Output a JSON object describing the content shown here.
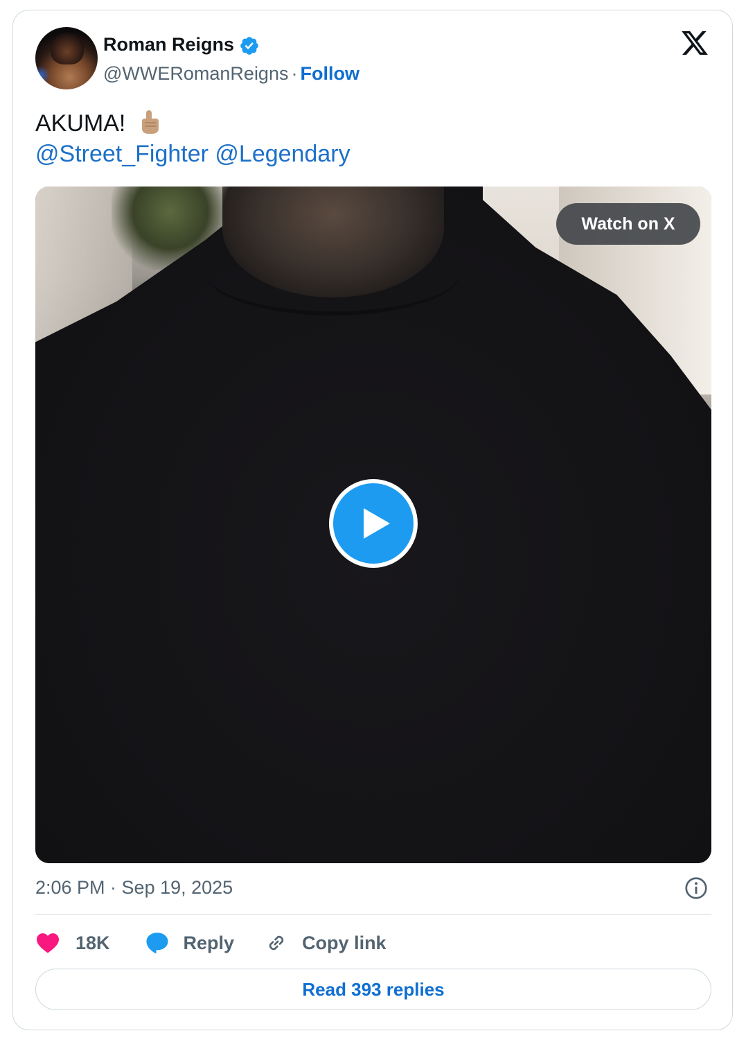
{
  "author": {
    "name": "Roman Reigns",
    "handle": "@WWERomanReigns",
    "separator": "·",
    "follow_label": "Follow",
    "verified": true
  },
  "tweet": {
    "text": "AKUMA!",
    "emoji": "pointing-up-emoji",
    "mentions": [
      "@Street_Fighter",
      "@Legendary"
    ]
  },
  "media": {
    "watch_label": "Watch on X",
    "play_icon": "play-icon"
  },
  "meta": {
    "timestamp": "2:06 PM · Sep 19, 2025"
  },
  "actions": {
    "like_count": "18K",
    "reply_label": "Reply",
    "copy_label": "Copy link",
    "read_replies_label": "Read 393 replies"
  },
  "colors": {
    "link": "#1d70c8",
    "follow": "#0f6ed1",
    "like": "#f91880",
    "reply": "#1d9bf0",
    "muted": "#536471",
    "border": "#cfd9de"
  }
}
